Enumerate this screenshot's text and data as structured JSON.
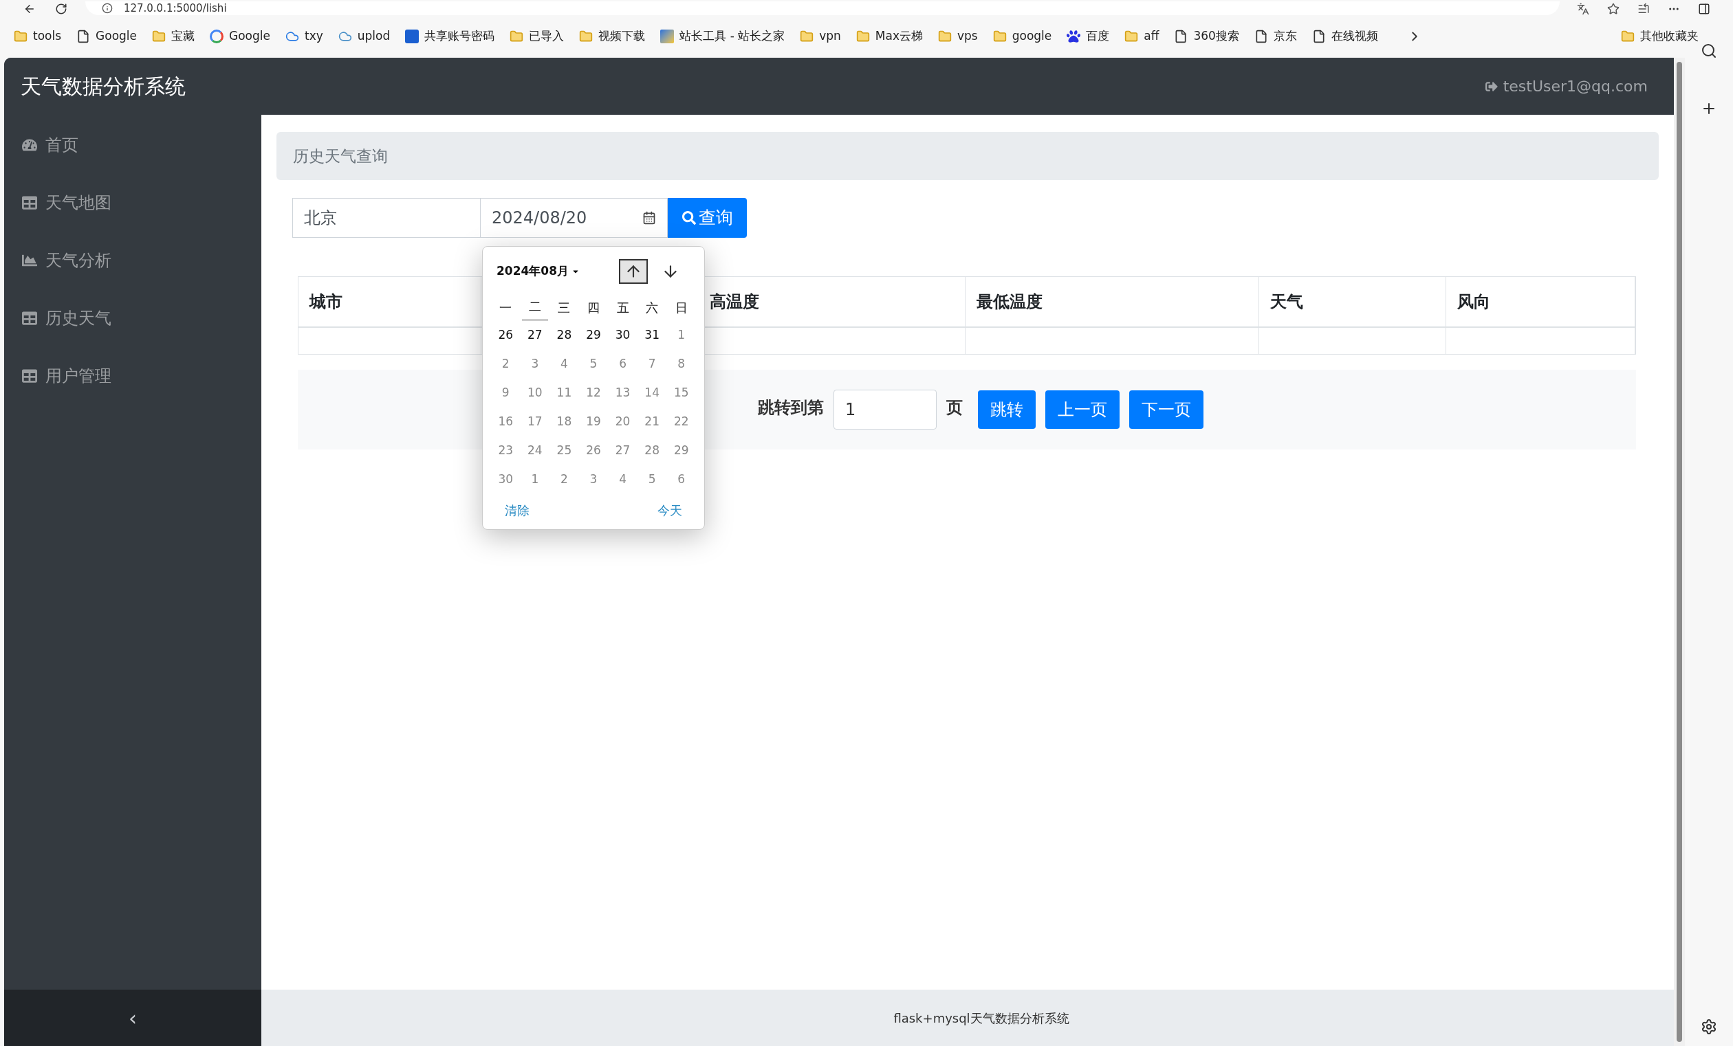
{
  "browser": {
    "url": "127.0.0.1:5000/lishi",
    "bookmarks": [
      {
        "label": "tools"
      },
      {
        "label": "Google"
      },
      {
        "label": "宝藏"
      },
      {
        "label": "Google"
      },
      {
        "label": "txy"
      },
      {
        "label": "uplod"
      },
      {
        "label": "共享账号密码"
      },
      {
        "label": "已导入"
      },
      {
        "label": "视频下载"
      },
      {
        "label": "站长工具 - 站长之家"
      },
      {
        "label": "vpn"
      },
      {
        "label": "Max云梯"
      },
      {
        "label": "vps"
      },
      {
        "label": "google"
      },
      {
        "label": "百度"
      },
      {
        "label": "aff"
      },
      {
        "label": "360搜索"
      },
      {
        "label": "京东"
      },
      {
        "label": "在线视频"
      }
    ],
    "other_bookmarks": "其他收藏夹"
  },
  "app": {
    "title": "天气数据分析系统",
    "user": "testUser1@qq.com"
  },
  "sidebar": {
    "items": [
      {
        "label": "首页",
        "selected": false
      },
      {
        "label": "天气地图",
        "selected": false
      },
      {
        "label": "天气分析",
        "selected": false
      },
      {
        "label": "历史天气",
        "selected": false
      },
      {
        "label": "用户管理",
        "selected": false
      }
    ],
    "toggle": "‹"
  },
  "breadcrumb": "历史天气查询",
  "search": {
    "city": "北京",
    "date": "2024/08/20",
    "button": "查询"
  },
  "datepicker": {
    "month": "2024年08月",
    "up_focused": true,
    "down_focused": false,
    "weekdays": [
      {
        "label": "一",
        "hovered": false
      },
      {
        "label": "二",
        "hovered": true
      },
      {
        "label": "三",
        "hovered": false
      },
      {
        "label": "四",
        "hovered": false
      },
      {
        "label": "五",
        "hovered": false
      },
      {
        "label": "六",
        "hovered": false
      },
      {
        "label": "日",
        "hovered": false
      }
    ],
    "weeks": [
      [
        {
          "text": "26",
          "muted": false
        },
        {
          "text": "27",
          "muted": false
        },
        {
          "text": "28",
          "muted": false
        },
        {
          "text": "29",
          "muted": false
        },
        {
          "text": "30",
          "muted": false
        },
        {
          "text": "31",
          "muted": false
        },
        {
          "text": "1",
          "muted": true
        }
      ],
      [
        {
          "text": "2",
          "muted": true
        },
        {
          "text": "3",
          "muted": true
        },
        {
          "text": "4",
          "muted": true
        },
        {
          "text": "5",
          "muted": true
        },
        {
          "text": "6",
          "muted": true
        },
        {
          "text": "7",
          "muted": true
        },
        {
          "text": "8",
          "muted": true
        }
      ],
      [
        {
          "text": "9",
          "muted": true
        },
        {
          "text": "10",
          "muted": true
        },
        {
          "text": "11",
          "muted": true
        },
        {
          "text": "12",
          "muted": true
        },
        {
          "text": "13",
          "muted": true
        },
        {
          "text": "14",
          "muted": true
        },
        {
          "text": "15",
          "muted": true
        }
      ],
      [
        {
          "text": "16",
          "muted": true
        },
        {
          "text": "17",
          "muted": true
        },
        {
          "text": "18",
          "muted": true
        },
        {
          "text": "19",
          "muted": true
        },
        {
          "text": "20",
          "muted": true
        },
        {
          "text": "21",
          "muted": true
        },
        {
          "text": "22",
          "muted": true
        }
      ],
      [
        {
          "text": "23",
          "muted": true
        },
        {
          "text": "24",
          "muted": true
        },
        {
          "text": "25",
          "muted": true
        },
        {
          "text": "26",
          "muted": true
        },
        {
          "text": "27",
          "muted": true
        },
        {
          "text": "28",
          "muted": true
        },
        {
          "text": "29",
          "muted": true
        }
      ],
      [
        {
          "text": "30",
          "muted": true
        },
        {
          "text": "1",
          "muted": true
        },
        {
          "text": "2",
          "muted": true
        },
        {
          "text": "3",
          "muted": true
        },
        {
          "text": "4",
          "muted": true
        },
        {
          "text": "5",
          "muted": true
        },
        {
          "text": "6",
          "muted": true
        }
      ]
    ],
    "clear": "清除",
    "today": "今天"
  },
  "table": {
    "columns": [
      "城市",
      "高温度",
      "最低温度",
      "天气",
      "风向"
    ]
  },
  "pagination": {
    "label": "跳转到第",
    "page": "1",
    "unit": "页",
    "buttons": [
      "跳转",
      "上一页",
      "下一页"
    ]
  },
  "footer": "flask+mysql天气数据分析系统"
}
